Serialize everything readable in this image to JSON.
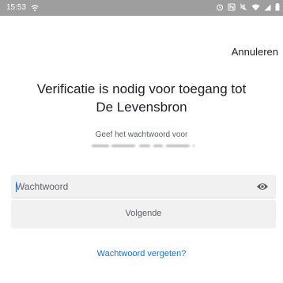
{
  "status_bar": {
    "time": "15:53",
    "left_icons": [
      "wifi-calling-icon"
    ],
    "right_icons": [
      "alarm-icon",
      "nfc-icon",
      "mute-icon",
      "wifi-icon",
      "signal-icon",
      "battery-icon"
    ]
  },
  "header": {
    "cancel_label": "Annuleren"
  },
  "main": {
    "title_line1": "Verificatie is nodig voor toegang tot",
    "title_line2": "De Levensbron",
    "subtitle": "Geef het wachtwoord voor",
    "password": {
      "placeholder": "Wachtwoord",
      "value": ""
    },
    "next_label": "Volgende",
    "forgot_label": "Wachtwoord vergeten?"
  },
  "colors": {
    "status_bar": "#9e9e9e",
    "accent": "#1a73e8",
    "field_bg": "#f1f1f1"
  }
}
